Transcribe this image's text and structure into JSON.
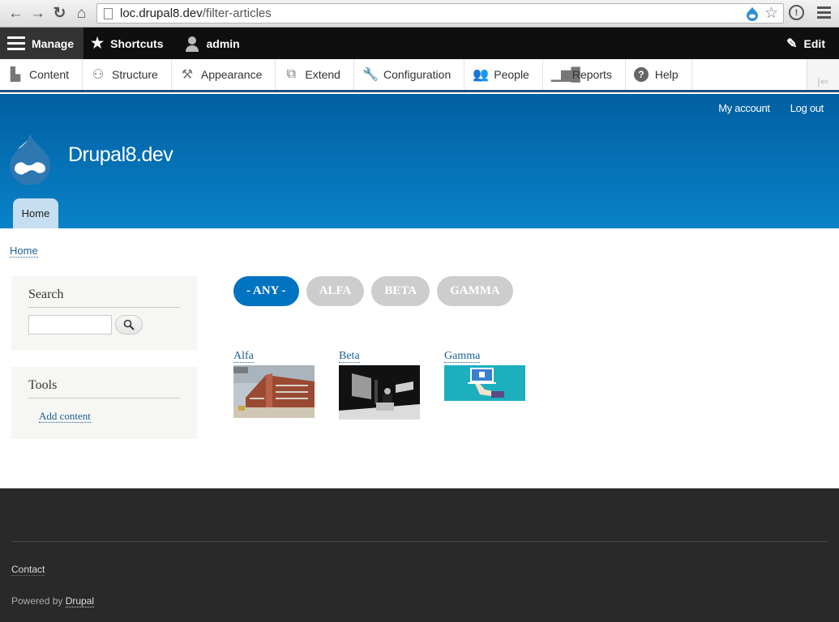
{
  "browser": {
    "url_host": "loc.drupal8.dev",
    "url_path": "/filter-articles"
  },
  "toolbar": {
    "manage": "Manage",
    "shortcuts": "Shortcuts",
    "user": "admin",
    "edit": "Edit"
  },
  "tray": {
    "items": [
      {
        "label": "Content",
        "icon": "file-icon"
      },
      {
        "label": "Structure",
        "icon": "sitemap-icon"
      },
      {
        "label": "Appearance",
        "icon": "brush-icon"
      },
      {
        "label": "Extend",
        "icon": "puzzle-icon"
      },
      {
        "label": "Configuration",
        "icon": "wrench-icon"
      },
      {
        "label": "People",
        "icon": "people-icon"
      },
      {
        "label": "Reports",
        "icon": "bar-chart-icon"
      },
      {
        "label": "Help",
        "icon": "help-icon"
      }
    ]
  },
  "header": {
    "secondary_menu": [
      "My account",
      "Log out"
    ],
    "site_name": "Drupal8.dev",
    "main_tab": "Home"
  },
  "breadcrumb": "Home",
  "sidebar": {
    "search_title": "Search",
    "search_value": "",
    "tools_title": "Tools",
    "tools_link": "Add content"
  },
  "filters": [
    "- ANY -",
    "ALFA",
    "BETA",
    "GAMMA"
  ],
  "active_filter": "- ANY -",
  "articles": [
    {
      "title": "Alfa",
      "image": "building-photo"
    },
    {
      "title": "Beta",
      "image": "bw-person-photo"
    },
    {
      "title": "Gamma",
      "image": "facebook-laptop-illustration"
    }
  ],
  "footer": {
    "contact": "Contact",
    "powered_prefix": "Powered by ",
    "powered_link": "Drupal"
  },
  "colors": {
    "accent": "#0073c1",
    "header_top": "#005fa0",
    "header_bottom": "#0a82c9",
    "footer": "#292929"
  }
}
